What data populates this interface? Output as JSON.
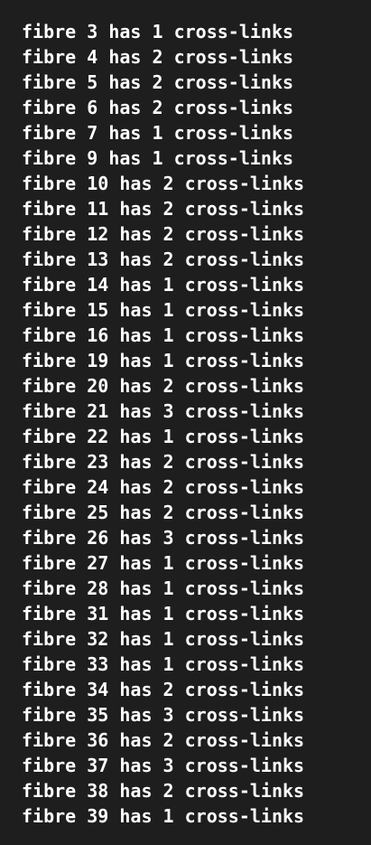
{
  "colors": {
    "background": "#1e1e1e",
    "text": "#ffffff"
  },
  "terminal": {
    "lines": [
      "fibre 3 has 1 cross-links",
      "fibre 4 has 2 cross-links",
      "fibre 5 has 2 cross-links",
      "fibre 6 has 2 cross-links",
      "fibre 7 has 1 cross-links",
      "fibre 9 has 1 cross-links",
      "fibre 10 has 2 cross-links",
      "fibre 11 has 2 cross-links",
      "fibre 12 has 2 cross-links",
      "fibre 13 has 2 cross-links",
      "fibre 14 has 1 cross-links",
      "fibre 15 has 1 cross-links",
      "fibre 16 has 1 cross-links",
      "fibre 19 has 1 cross-links",
      "fibre 20 has 2 cross-links",
      "fibre 21 has 3 cross-links",
      "fibre 22 has 1 cross-links",
      "fibre 23 has 2 cross-links",
      "fibre 24 has 2 cross-links",
      "fibre 25 has 2 cross-links",
      "fibre 26 has 3 cross-links",
      "fibre 27 has 1 cross-links",
      "fibre 28 has 1 cross-links",
      "fibre 31 has 1 cross-links",
      "fibre 32 has 1 cross-links",
      "fibre 33 has 1 cross-links",
      "fibre 34 has 2 cross-links",
      "fibre 35 has 3 cross-links",
      "fibre 36 has 2 cross-links",
      "fibre 37 has 3 cross-links",
      "fibre 38 has 2 cross-links",
      "fibre 39 has 1 cross-links"
    ]
  }
}
